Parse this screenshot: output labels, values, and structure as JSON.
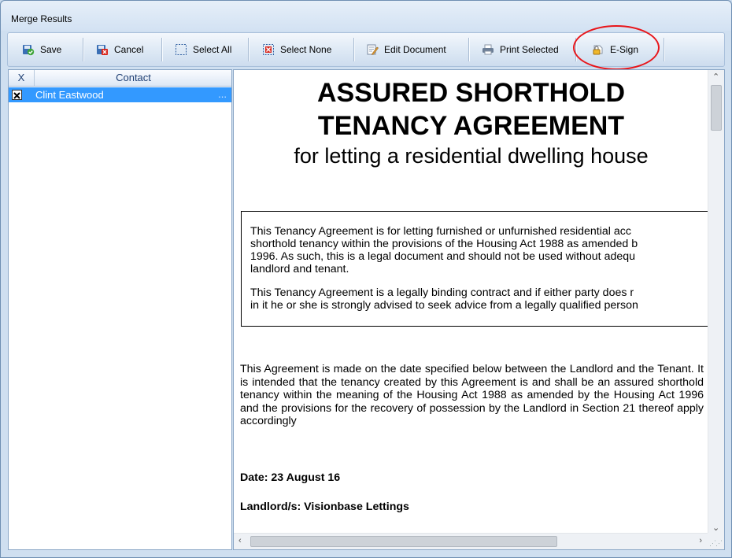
{
  "window": {
    "title": "Merge Results"
  },
  "toolbar": {
    "buttons": [
      {
        "label": "Save",
        "icon": "save-icon"
      },
      {
        "label": "Cancel",
        "icon": "cancel-icon"
      },
      {
        "label": "Select All",
        "icon": "select-all-icon"
      },
      {
        "label": "Select None",
        "icon": "select-none-icon"
      },
      {
        "label": "Edit Document",
        "icon": "edit-document-icon"
      },
      {
        "label": "Print Selected",
        "icon": "printer-icon"
      },
      {
        "label": "E-Sign",
        "icon": "e-sign-icon"
      }
    ],
    "highlight_color": "#e8161b"
  },
  "grid": {
    "columns": [
      "X",
      "Contact"
    ],
    "rows": [
      {
        "checked": true,
        "contact": "Clint Eastwood",
        "ellipsis": "..."
      }
    ],
    "selection_color": "#3399ff"
  },
  "document": {
    "title_line1": "ASSURED SHORTHOLD",
    "title_line2": "TENANCY AGREEMENT",
    "subtitle": "for letting a residential dwelling house",
    "box_para1_lines": [
      "This Tenancy Agreement is for letting furnished or unfurnished residential acc",
      "shorthold tenancy within the provisions of the Housing Act 1988 as amended b",
      "1996. As such, this is a legal document and should not be used without adequ",
      "landlord and tenant."
    ],
    "box_para2_lines": [
      "This Tenancy Agreement is a legally binding contract and if either party does r",
      "in it he or she is strongly advised to seek advice from a legally qualified person"
    ],
    "agreement_paragraph": "This Agreement is made on the date specified below between the Landlord and the Tenant. It is intended that the tenancy created by this Agreement is and shall be an assured shorthold tenancy within the meaning of the Housing Act 1988 as amended by the Housing Act 1996 and the provisions for the recovery of possession by the Landlord in Section 21 thereof apply accordingly",
    "date_line": "Date: 23 August 16",
    "landlord_line": "Landlord/s: Visionbase Lettings"
  }
}
